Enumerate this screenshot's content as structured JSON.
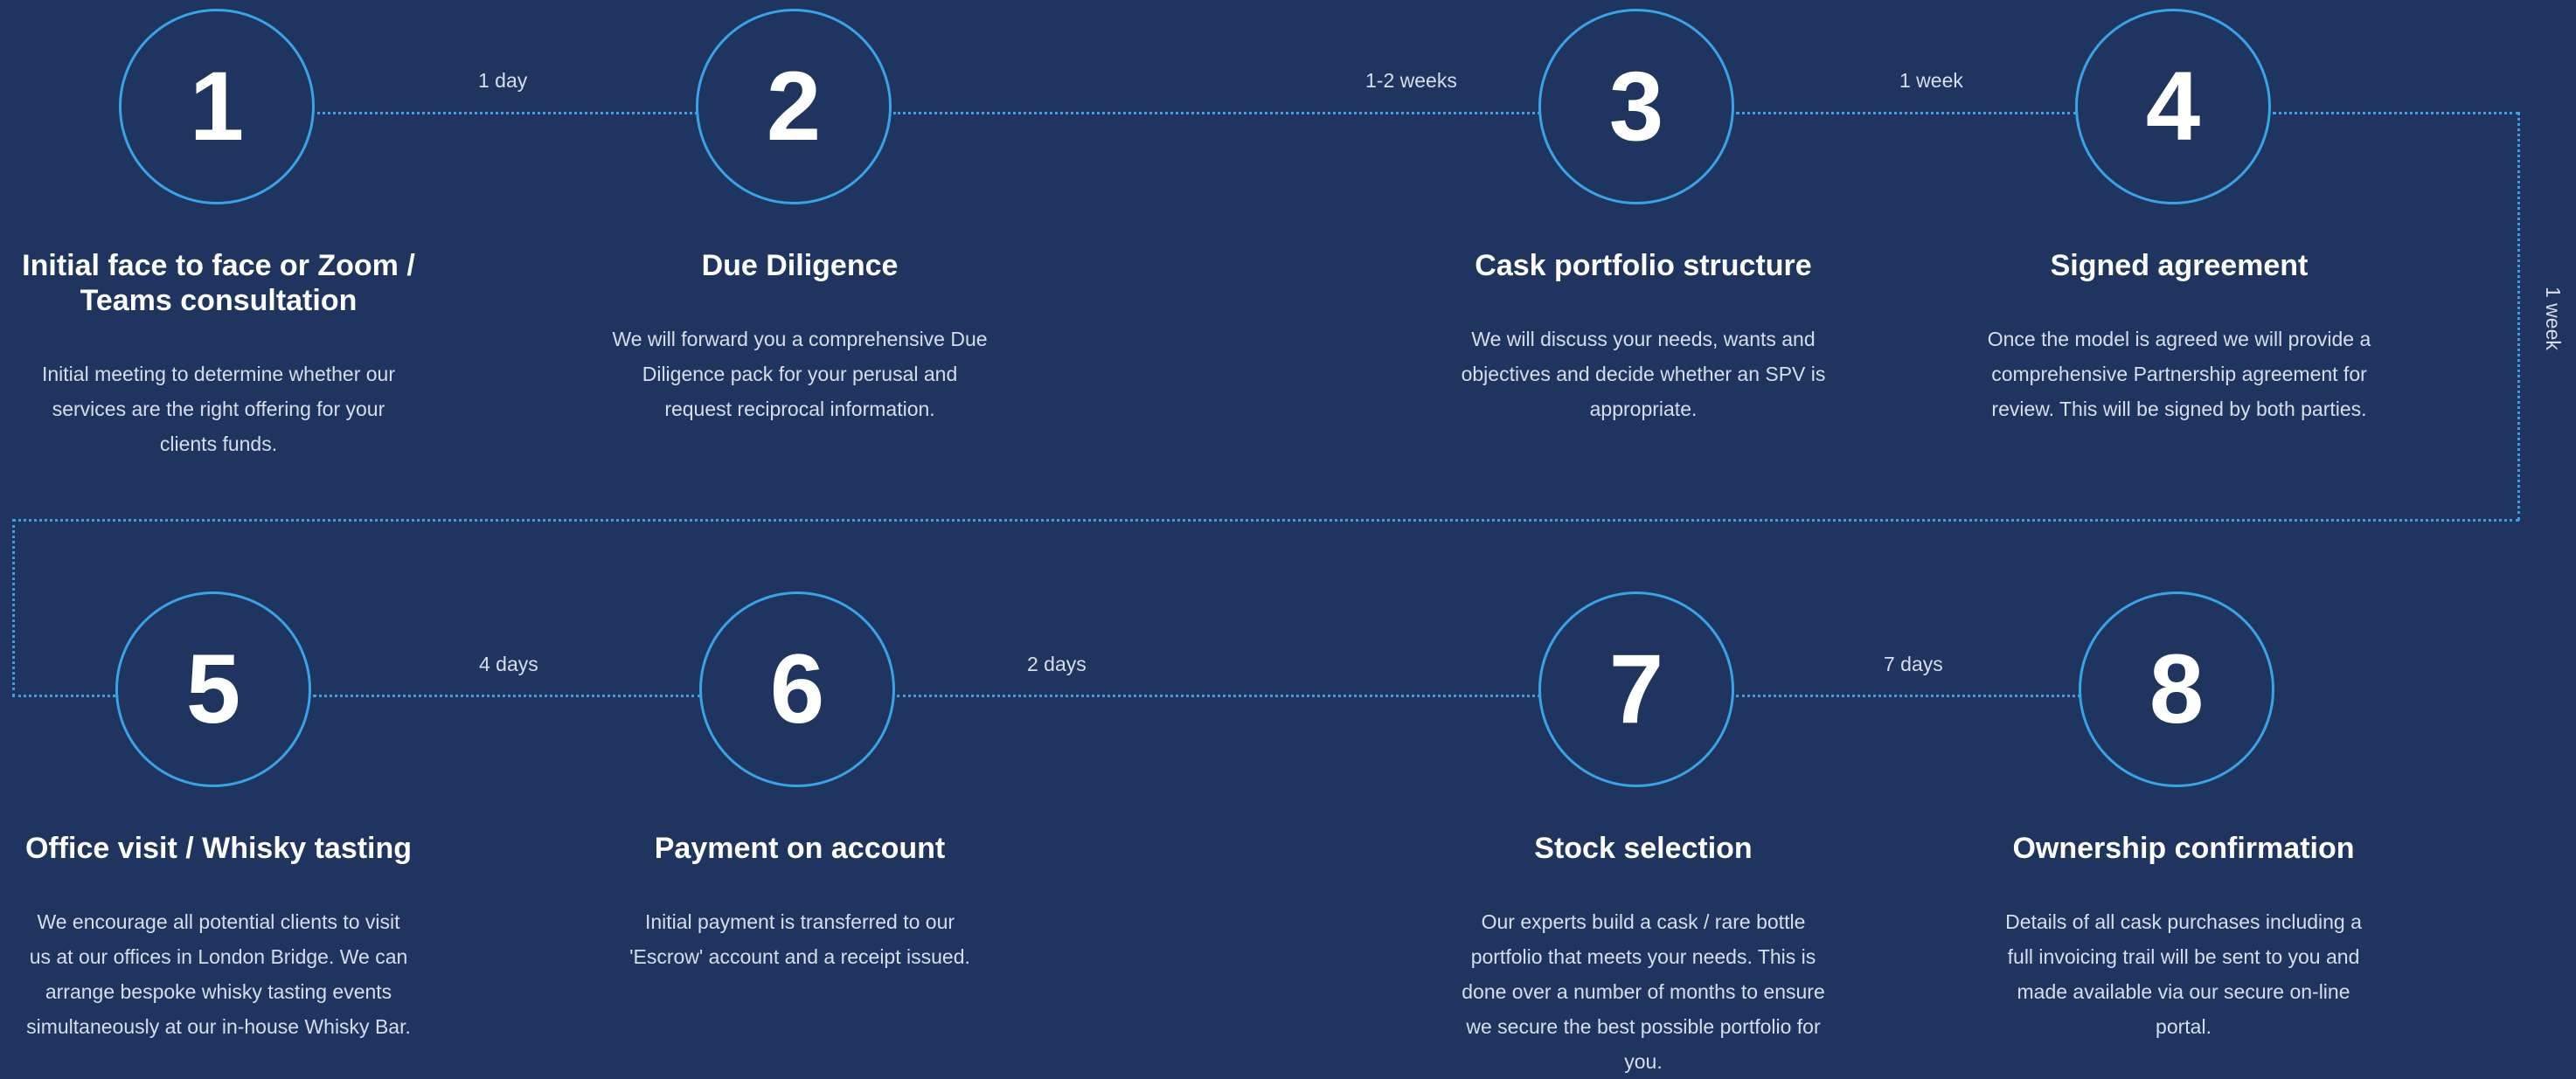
{
  "steps": [
    {
      "number": "1",
      "title": "Initial face to face or Zoom / Teams consultation",
      "description": "Initial meeting to determine whether our services are the right offering for your clients funds."
    },
    {
      "number": "2",
      "title": "Due Diligence",
      "description": "We will forward you a comprehensive Due Diligence pack for your perusal and request reciprocal information."
    },
    {
      "number": "3",
      "title": "Cask portfolio structure",
      "description": "We will discuss your needs, wants and objectives and decide whether an SPV is appropriate."
    },
    {
      "number": "4",
      "title": "Signed agreement",
      "description": "Once the model is agreed we will provide a comprehensive Partnership agreement for review. This will be signed by both parties."
    },
    {
      "number": "5",
      "title": "Office visit / Whisky tasting",
      "description": "We encourage all potential clients to visit us at our offices in London Bridge. We can arrange bespoke whisky tasting events simultaneously at our in-house Whisky Bar."
    },
    {
      "number": "6",
      "title": "Payment on account",
      "description": "Initial payment is transferred to our 'Escrow' account and a receipt issued."
    },
    {
      "number": "7",
      "title": "Stock selection",
      "description": "Our experts build a cask / rare bottle portfolio that meets your needs. This is done over a number of months to ensure we secure the best possible portfolio for you."
    },
    {
      "number": "8",
      "title": "Ownership confirmation",
      "description": "Details of all cask purchases including a full invoicing trail will be sent to you and made available via our secure on-line portal."
    }
  ],
  "durations": {
    "d1_2": "1 day",
    "d2_3": "1-2 weeks",
    "d3_4": "1 week",
    "d4_5": "1 week",
    "d5_6": "4 days",
    "d6_7": "2 days",
    "d7_8": "7 days"
  },
  "colors": {
    "background": "#1f3560",
    "accent": "#35a4e8",
    "connector": "#3b9fe0"
  }
}
